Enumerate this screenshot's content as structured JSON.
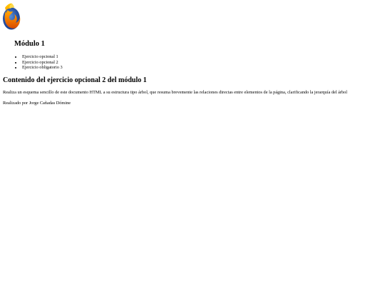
{
  "header": {
    "logo_icon": "firefox-logo-icon"
  },
  "nav": {
    "title": "Módulo 1",
    "items": [
      {
        "label": "Ejercicio opcional 1"
      },
      {
        "label": "Ejercicio opcional 2"
      },
      {
        "label": "Ejercicio obligatorio 3"
      }
    ]
  },
  "content": {
    "title": "Contenido del ejercicio opcional 2 del módulo 1",
    "text": "Realiza un esquema sencillo de este documento HTML a su estructura tipo árbol, que resuma brevemente las relaciones directas entre elementos de la página, clarificando la jerarquía del árbol"
  },
  "footer": {
    "author": "Realizado por Jorge Cañadas Dómine"
  },
  "colors": {
    "text": "#000000",
    "background": "#ffffff",
    "logo_orange": "#e66000",
    "logo_yellow": "#ffcb00",
    "logo_blue": "#1d3f8f"
  }
}
